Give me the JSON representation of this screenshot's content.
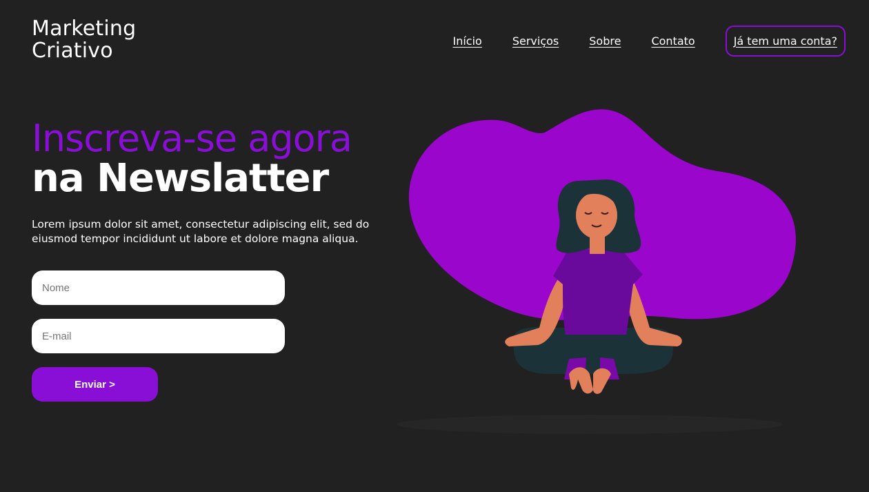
{
  "brand": {
    "line1": "Marketing",
    "line2": "Criativo"
  },
  "nav": {
    "items": [
      {
        "label": "Início"
      },
      {
        "label": "Serviços"
      },
      {
        "label": "Sobre"
      },
      {
        "label": "Contato"
      }
    ],
    "account_label": "Já tem uma conta?"
  },
  "hero": {
    "title_accent": "Inscreva-se agora",
    "title_main": "na Newslatter",
    "description": "Lorem ipsum dolor sit amet, consectetur adipiscing elit, sed do eiusmod tempor incididunt ut labore et dolore magna aliqua."
  },
  "form": {
    "name_placeholder": "Nome",
    "email_placeholder": "E-mail",
    "submit_label": "Enviar >"
  },
  "colors": {
    "background": "#212121",
    "accent": "#8a0fd6",
    "blob": "#9a06cc",
    "text": "#ffffff"
  }
}
